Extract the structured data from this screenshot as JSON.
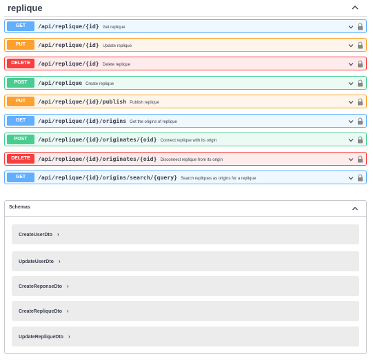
{
  "tag": {
    "name": "replique"
  },
  "operations": [
    {
      "method": "GET",
      "kind": "get",
      "path": "/api/replique/{id}",
      "summary": "Get replique"
    },
    {
      "method": "PUT",
      "kind": "put",
      "path": "/api/replique/{id}",
      "summary": "Update replique"
    },
    {
      "method": "DELETE",
      "kind": "delete",
      "path": "/api/replique/{id}",
      "summary": "Delete replique"
    },
    {
      "method": "POST",
      "kind": "post",
      "path": "/api/replique",
      "summary": "Create replique"
    },
    {
      "method": "PUT",
      "kind": "put",
      "path": "/api/replique/{id}/publish",
      "summary": "Publish replique"
    },
    {
      "method": "GET",
      "kind": "get",
      "path": "/api/replique/{id}/origins",
      "summary": "Get the origins of replique"
    },
    {
      "method": "POST",
      "kind": "post",
      "path": "/api/replique/{id}/originates/{oid}",
      "summary": "Connect replique with its origin"
    },
    {
      "method": "DELETE",
      "kind": "delete",
      "path": "/api/replique/{id}/originates/{oid}",
      "summary": "Disconnect replique from its origin"
    },
    {
      "method": "GET",
      "kind": "get",
      "path": "/api/replique/{id}/origins/search/{query}",
      "summary": "Search repliques as origins for a replique"
    }
  ],
  "schemas": {
    "title": "Schemas",
    "models": [
      {
        "name": "CreateUserDto",
        "arrow": "›"
      },
      {
        "name": "UpdateUserDto",
        "arrow": "›"
      },
      {
        "name": "CreateReponseDto",
        "arrow": "›"
      },
      {
        "name": "CreateRepliqueDto",
        "arrow": "›"
      },
      {
        "name": "UpdateRepliqueDto",
        "arrow": "›"
      }
    ]
  },
  "colors": {
    "get": "#61affe",
    "put": "#fca130",
    "delete": "#f93e3e",
    "post": "#49cc90",
    "text": "#3b4151"
  },
  "icons": {
    "expand": "chevron-down-icon",
    "collapse": "chevron-up-icon",
    "auth": "lock-icon"
  }
}
